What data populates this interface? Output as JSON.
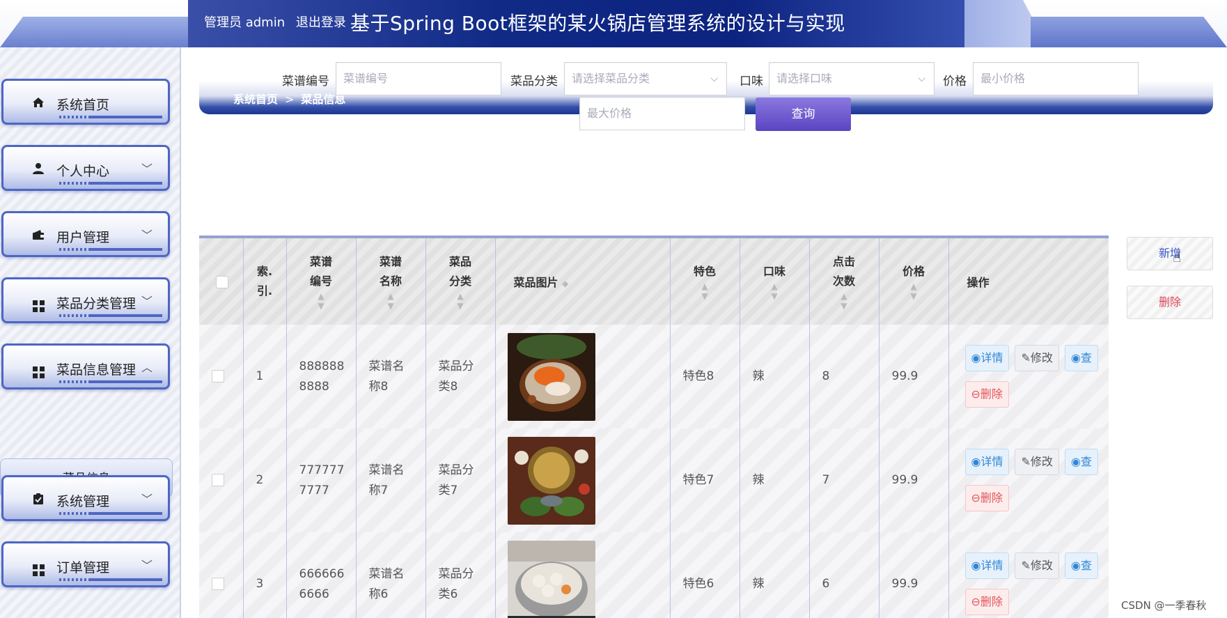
{
  "header": {
    "role": "管理员 admin",
    "logout": "退出登录",
    "title": "基于Spring Boot框架的某火锅店管理系统的设计与实现"
  },
  "sidebar": {
    "items": [
      {
        "label": "系统首页",
        "icon": "home-icon"
      },
      {
        "label": "个人中心",
        "icon": "user-icon",
        "arrow": "chevron-down"
      },
      {
        "label": "用户管理",
        "icon": "wallet-icon",
        "arrow": "chevron-down"
      },
      {
        "label": "菜品分类管理",
        "icon": "grid-icon",
        "arrow": "chevron-down"
      },
      {
        "label": "菜品信息管理",
        "icon": "grid-icon",
        "arrow": "chevron-up"
      },
      {
        "label": "系统管理",
        "icon": "clipboard-icon",
        "arrow": "chevron-down"
      },
      {
        "label": "订单管理",
        "icon": "grid-icon",
        "arrow": "chevron-down"
      }
    ],
    "submenu": {
      "label": "菜品信息"
    }
  },
  "breadcrumb": {
    "home": "系统首页",
    "separator": ">",
    "current": "菜品信息"
  },
  "search": {
    "code_label": "菜谱编号",
    "code_placeholder": "菜谱编号",
    "category_label": "菜品分类",
    "category_placeholder": "请选择菜品分类",
    "taste_label": "口味",
    "taste_placeholder": "请选择口味",
    "price_label": "价格",
    "min_price_placeholder": "最小价格",
    "max_price_placeholder": "最大价格",
    "query_button": "查询"
  },
  "actions": {
    "add": "新增",
    "delete": "删除"
  },
  "table": {
    "headers": {
      "index": [
        "索.",
        "引."
      ],
      "code": [
        "菜谱",
        "编号"
      ],
      "name": [
        "菜谱",
        "名称"
      ],
      "category": [
        "菜品",
        "分类"
      ],
      "image": "菜品图片",
      "feature": "特色",
      "taste": "口味",
      "clicks": [
        "点击",
        "次数"
      ],
      "price": "价格",
      "ops": "操作"
    },
    "rows": [
      {
        "index": "1",
        "code": [
          "888888",
          "8888"
        ],
        "name": [
          "菜谱名",
          "称8"
        ],
        "category": [
          "菜品分",
          "类8"
        ],
        "feature": "特色8",
        "taste": "辣",
        "clicks": "8",
        "price": "99.9"
      },
      {
        "index": "2",
        "code": [
          "777777",
          "7777"
        ],
        "name": [
          "菜谱名",
          "称7"
        ],
        "category": [
          "菜品分",
          "类7"
        ],
        "feature": "特色7",
        "taste": "辣",
        "clicks": "7",
        "price": "99.9"
      },
      {
        "index": "3",
        "code": [
          "666666",
          "6666"
        ],
        "name": [
          "菜谱名",
          "称6"
        ],
        "category": [
          "菜品分",
          "类6"
        ],
        "feature": "特色6",
        "taste": "辣",
        "clicks": "6",
        "price": "99.9"
      }
    ],
    "op_labels": {
      "detail": "详情",
      "edit": "修改",
      "view": "查",
      "delete": "删除"
    }
  },
  "watermark": "CSDN @一季春秋",
  "colors": {
    "primary": "#1c3590",
    "accent": "#5a44c2",
    "danger": "#e0565b",
    "link": "#2f86d6"
  }
}
